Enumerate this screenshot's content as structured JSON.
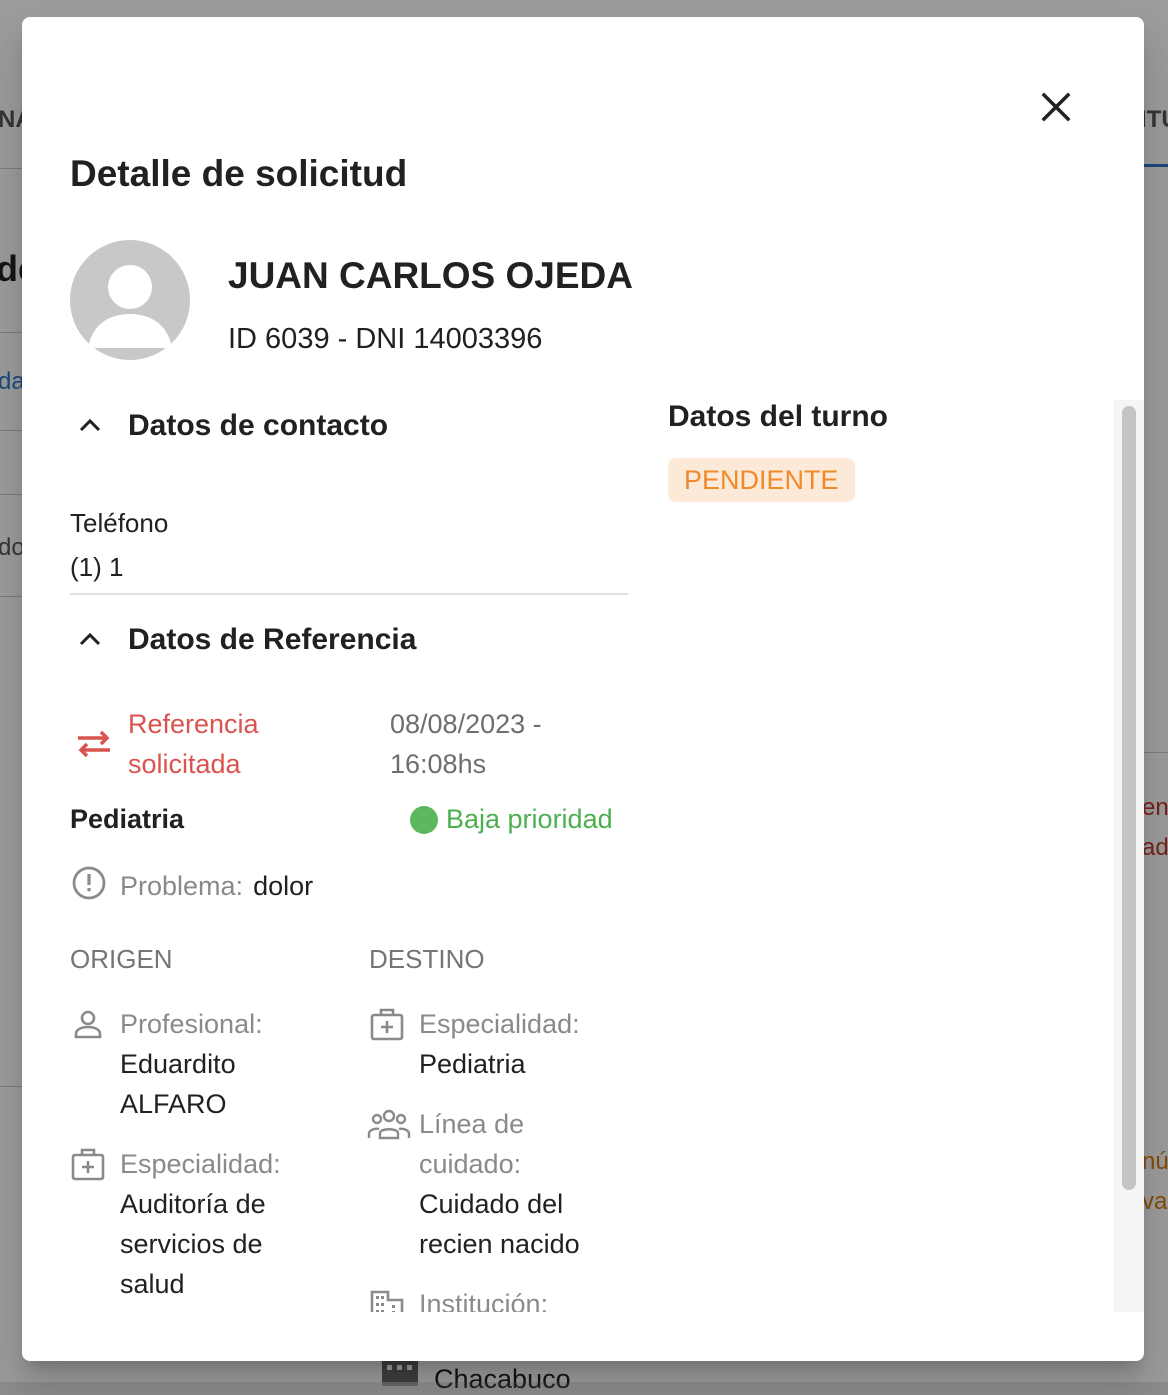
{
  "background": {
    "fragments": [
      "NA",
      "de",
      "da",
      "do",
      "en",
      "ad",
      "nú",
      "va",
      "ITU",
      "Chacabuco"
    ]
  },
  "dialog": {
    "title": "Detalle de solicitud",
    "close_icon": "close-icon"
  },
  "patient": {
    "name": "JUAN CARLOS OJEDA",
    "ids": "ID 6039 - DNI 14003396",
    "avatar_icon": "person-avatar-icon"
  },
  "contact": {
    "section_title": "Datos de contacto",
    "phone_label": "Teléfono",
    "phone_value": "(1) 1"
  },
  "reference": {
    "section_title": "Datos de Referencia",
    "status": "Referencia solicitada",
    "date": "08/08/2023 - 16:08hs",
    "specialty": "Pediatria",
    "priority": "Baja prioridad",
    "problem_label": "Problema:",
    "problem_value": "dolor",
    "origin": {
      "heading": "ORIGEN",
      "professional_label": "Profesional:",
      "professional_value": "Eduardito ALFARO",
      "specialty_label": "Especialidad:",
      "specialty_value": "Auditoría de servicios de salud"
    },
    "destination": {
      "heading": "DESTINO",
      "specialty_label": "Especialidad:",
      "specialty_value": "Pediatria",
      "care_line_label": "Línea de cuidado:",
      "care_line_value": "Cuidado del recien nacido",
      "institution_label": "Institución:"
    }
  },
  "appointment": {
    "title": "Datos del turno",
    "status": "PENDIENTE"
  },
  "colors": {
    "referral_red": "#d9534f",
    "priority_green": "#4caf50",
    "pending_orange": "#ee8a2a",
    "pending_bg": "#fde9d7"
  }
}
